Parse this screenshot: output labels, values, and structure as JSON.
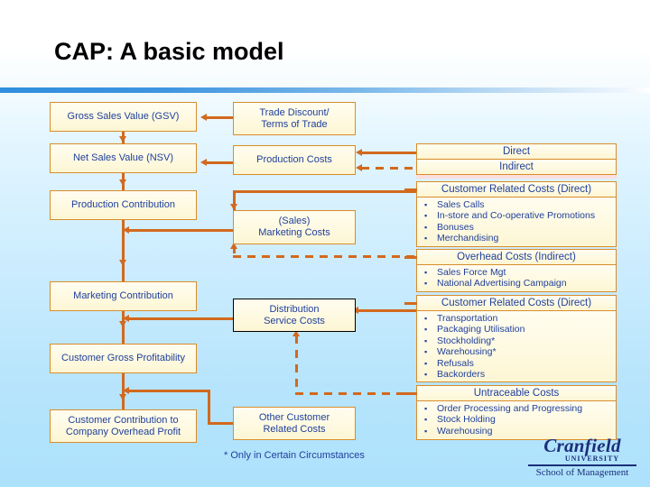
{
  "slide": {
    "title": "CAP:  A basic model",
    "footnote": "* Only in Certain Circumstances"
  },
  "flow": {
    "left": [
      {
        "label": "Gross Sales Value (GSV)"
      },
      {
        "label": "Net Sales Value (NSV)"
      },
      {
        "label": "Production Contribution"
      },
      {
        "label": "Marketing Contribution"
      },
      {
        "label": "Customer Gross Profitability"
      },
      {
        "label_line1": "Customer Contribution to",
        "label_line2": "Company Overhead Profit"
      }
    ],
    "middle": [
      {
        "label_line1": "Trade Discount/",
        "label_line2": "Terms of Trade"
      },
      {
        "label": "Production Costs"
      },
      {
        "label_line1": "(Sales)",
        "label_line2": "Marketing Costs"
      },
      {
        "label_line1": "Distribution",
        "label_line2": "Service Costs",
        "selected": true
      },
      {
        "label_line1": "Other Customer",
        "label_line2": "Related Costs"
      }
    ],
    "right": {
      "direct": "Direct",
      "indirect": "Indirect",
      "crc_direct_1": {
        "header": "Customer Related Costs (Direct)",
        "items": [
          "Sales Calls",
          "In-store and Co-operative Promotions",
          "Bonuses",
          "Merchandising"
        ]
      },
      "overhead_indirect": {
        "header": "Overhead Costs (Indirect)",
        "items": [
          "Sales Force Mgt",
          "National Advertising Campaign"
        ]
      },
      "crc_direct_2": {
        "header": "Customer Related Costs (Direct)",
        "items": [
          "Transportation",
          "Packaging Utilisation",
          "Stockholding*",
          "Warehousing*",
          "Refusals",
          "Backorders"
        ]
      },
      "untraceable": {
        "header": "Untraceable Costs",
        "items": [
          "Order Processing and Progressing",
          "Stock Holding",
          "Warehousing"
        ]
      }
    }
  },
  "logo": {
    "name": "Cranfield",
    "university": "UNIVERSITY",
    "school": "School of Management"
  },
  "colors": {
    "box_border": "#d98c2b",
    "box_fill": "#fdf6d4",
    "text": "#1f3f9c",
    "connector": "#d2691e",
    "accent_bar": "#2f8ede"
  }
}
